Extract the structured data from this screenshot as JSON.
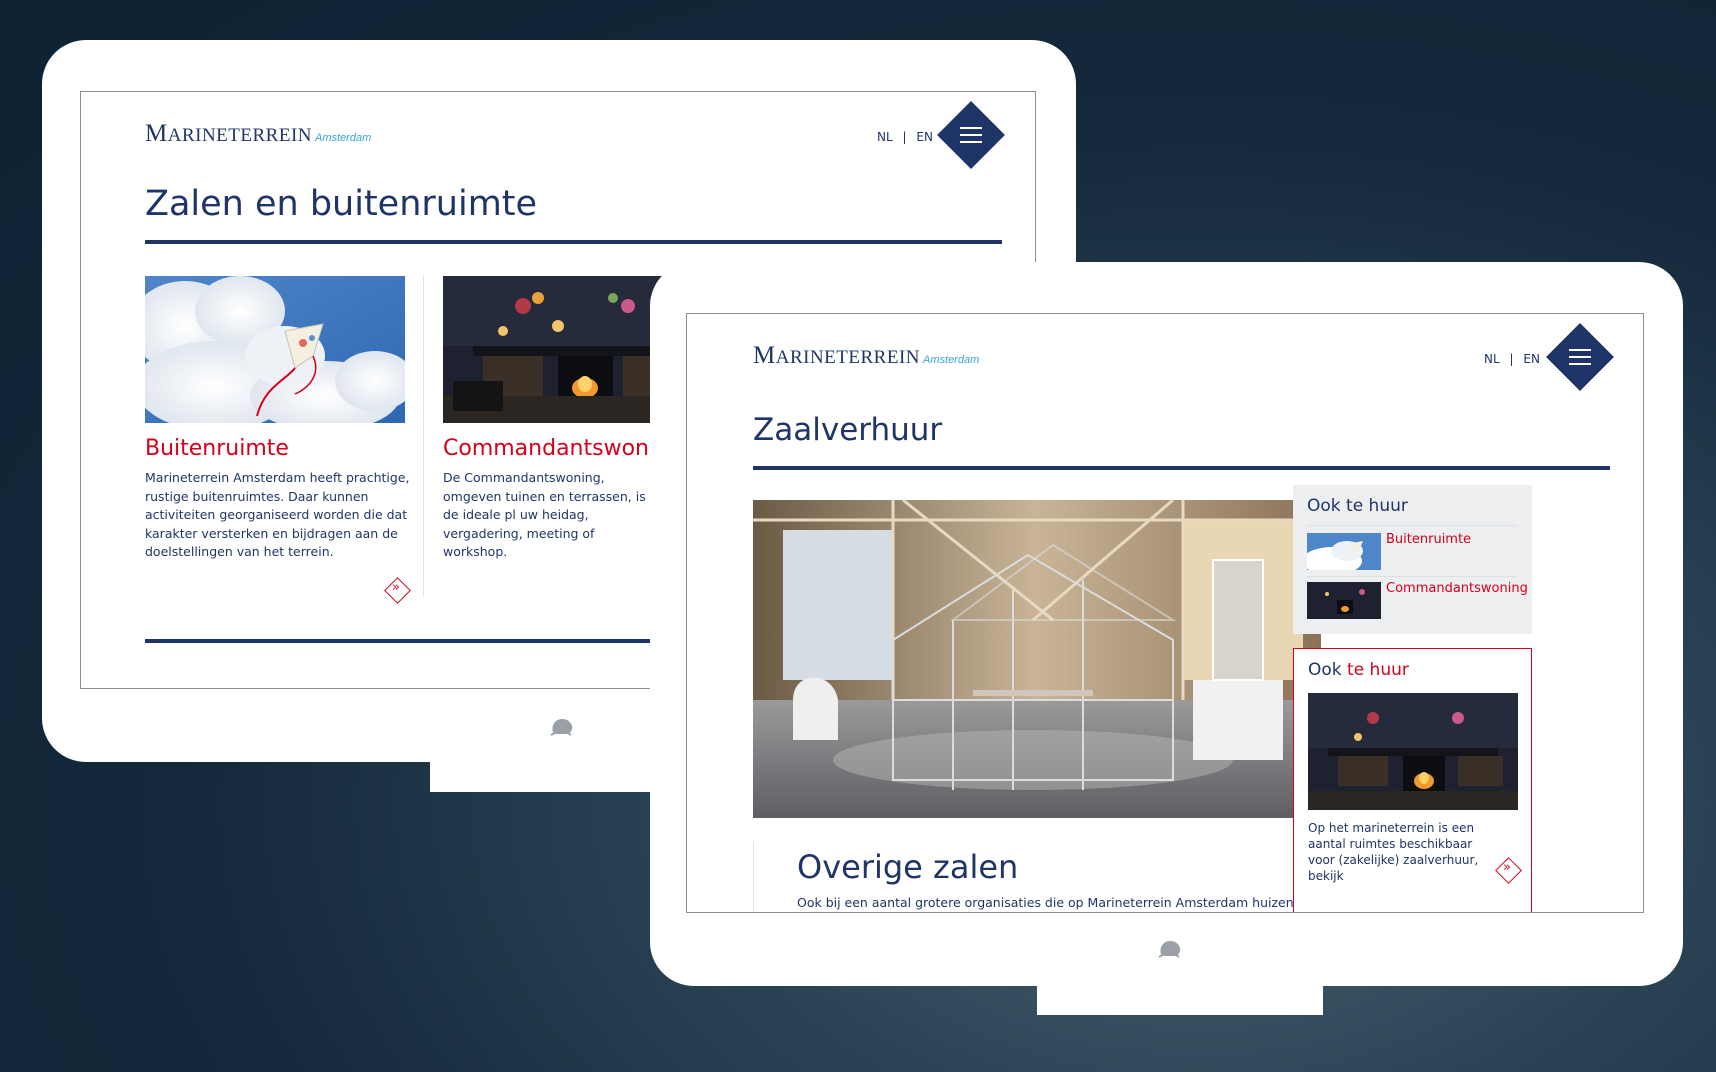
{
  "colors": {
    "navy": "#1f3567",
    "red": "#d6001c",
    "light_blue": "#3aa3d8",
    "panel_grey": "#edeef0"
  },
  "icons": {
    "menu": "hamburger-icon",
    "more": "double-chevron-right-icon",
    "frog": "frog-logo-icon"
  },
  "back_screen": {
    "logo": {
      "big_m": "M",
      "rest": "ARINETERREIN",
      "city": "Amsterdam"
    },
    "lang": {
      "nl": "NL",
      "sep": "|",
      "en": "EN"
    },
    "title": "Zalen en buitenruimte",
    "cards": [
      {
        "title": "Buitenruimte",
        "text": "Marineterrein Amsterdam heeft prachtige, rustige buitenruimtes. Daar kunnen activiteiten georganiseerd worden die dat karakter versterken en bijdragen aan de doelstellingen van het terrein.",
        "more": "»"
      },
      {
        "title": "Commandantswoni",
        "text": "De Commandantswoning, omgeven tuinen en terrassen, is de ideale pl uw heidag, vergadering, meeting of workshop."
      }
    ]
  },
  "front_screen": {
    "logo": {
      "big_m": "M",
      "rest": "ARINETERREIN",
      "city": "Amsterdam"
    },
    "lang": {
      "nl": "NL",
      "sep": "|",
      "en": "EN"
    },
    "title": "Zaalverhuur",
    "sidebar": {
      "title": "Ook te huur",
      "items": [
        {
          "label": "Buitenruimte"
        },
        {
          "label": "Commandantswoning"
        }
      ]
    },
    "ook_box": {
      "title_a": "Ook ",
      "title_b": "te huur",
      "text": "Op het marineterrein is een aantal ruimtes beschikbaar voor (zakelijke) zaalverhuur, bekijk",
      "more": "»"
    },
    "section": {
      "heading": "Overige zalen",
      "text": "Ook bij een aantal grotere organisaties die op Marineterrein Amsterdam huizen"
    }
  }
}
